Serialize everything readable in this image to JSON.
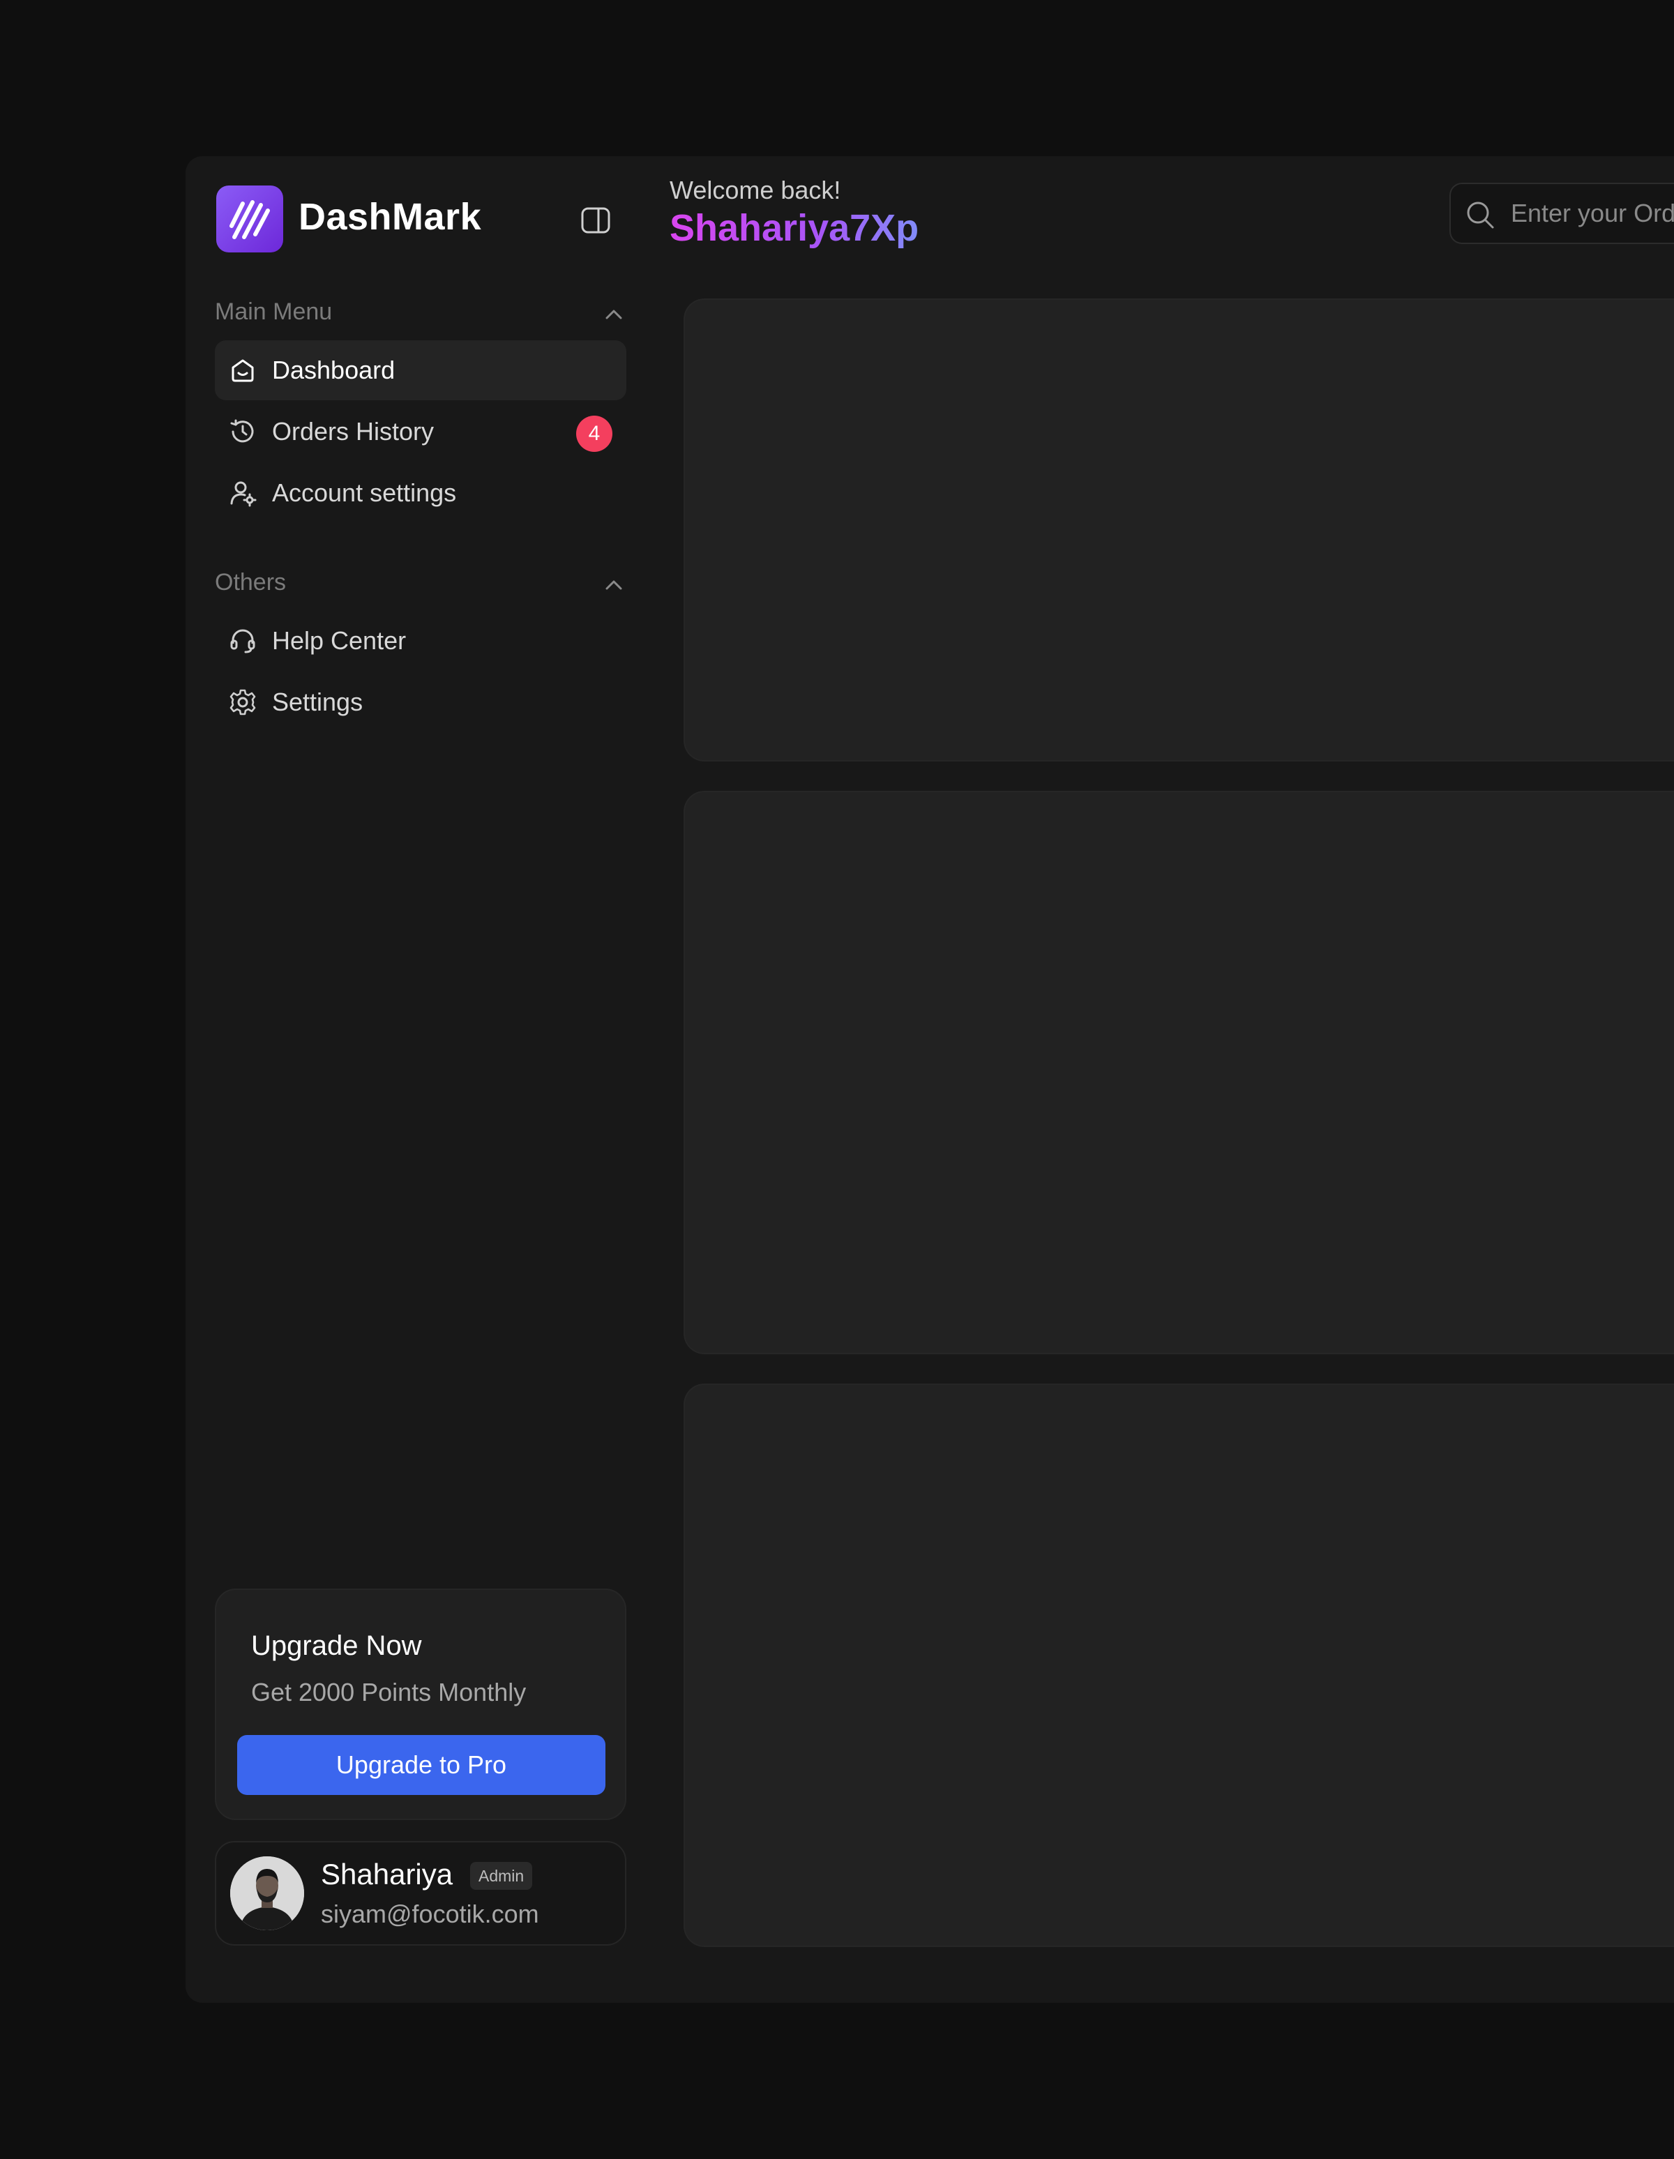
{
  "brand": {
    "name": "DashMark",
    "logo_icon": "slashes-logo-icon",
    "accent": "#7c3aed"
  },
  "sidebar": {
    "toggle_icon": "sidebar-toggle-icon",
    "main_menu": {
      "title": "Main Menu",
      "items": [
        {
          "label": "Dashboard",
          "icon": "home-icon",
          "active": true
        },
        {
          "label": "Orders History",
          "icon": "history-icon",
          "badge": "4"
        },
        {
          "label": "Account settings",
          "icon": "user-settings-icon"
        }
      ]
    },
    "others": {
      "title": "Others",
      "items": [
        {
          "label": "Help Center",
          "icon": "headset-icon"
        },
        {
          "label": "Settings",
          "icon": "gear-icon"
        }
      ]
    },
    "upgrade": {
      "title": "Upgrade Now",
      "subtitle": "Get 2000 Points Monthly",
      "button": "Upgrade to Pro",
      "button_color": "#3b66ee"
    },
    "user": {
      "name": "Shahariya",
      "role": "Admin",
      "email": "siyam@focotik.com"
    }
  },
  "header": {
    "greeting": "Welcome back!",
    "username": "Shahariya7Xp",
    "search_placeholder": "Enter your Order ID"
  },
  "colors": {
    "badge": "#f43f5e",
    "background": "#0f0f0f",
    "surface": "#181818",
    "panel": "#222222"
  }
}
